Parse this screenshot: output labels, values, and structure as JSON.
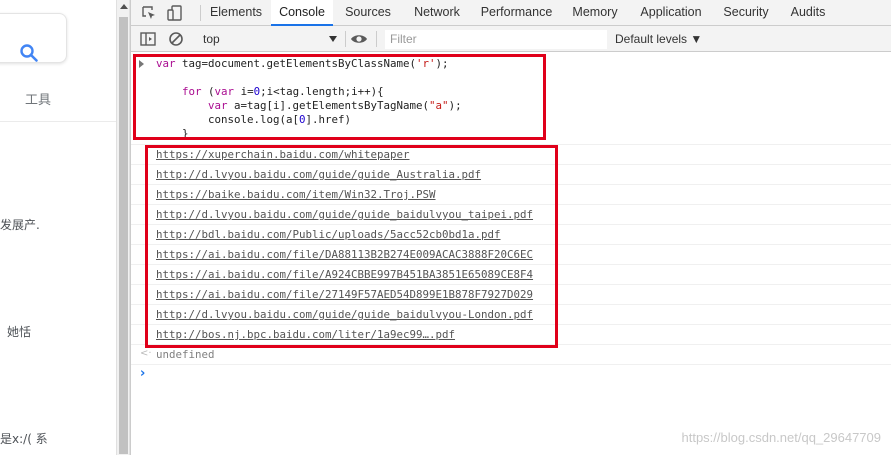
{
  "page": {
    "tools_label": "工具",
    "snippets": [
      "发展产.",
      "她恬",
      "是x:/( 系"
    ]
  },
  "devtools": {
    "tabs": [
      "Elements",
      "Console",
      "Sources",
      "Network",
      "Performance",
      "Memory",
      "Application",
      "Security",
      "Audits"
    ],
    "active_tab": "Console",
    "context": "top",
    "filter_placeholder": "Filter",
    "levels": "Default levels ▼"
  },
  "console": {
    "code_lines": [
      "var tag=document.getElementsByClassName('r');",
      "",
      "    for (var i=0;i<tag.length;i++){",
      "        var a=tag[i].getElementsByTagName(\"a\");",
      "        console.log(a[0].href)",
      "    }"
    ],
    "outputs": [
      "https://xuperchain.baidu.com/whitepaper",
      "http://d.lvyou.baidu.com/guide/guide_Australia.pdf",
      "https://baike.baidu.com/item/Win32.Troj.PSW",
      "http://d.lvyou.baidu.com/guide/guide_baidulvyou_taipei.pdf",
      "http://bdl.baidu.com/Public/uploads/5acc52cb0bd1a.pdf",
      "https://ai.baidu.com/file/DA88113B2B274E009ACAC3888F20C6EC",
      "https://ai.baidu.com/file/A924CBBE997B451BA3851E65089CE8F4",
      "https://ai.baidu.com/file/27149F57AED54D899E1B878F7927D029",
      "http://d.lvyou.baidu.com/guide/guide_baidulvyou-London.pdf",
      "http://bos.nj.bpc.baidu.com/liter/1a9ec99….pdf"
    ],
    "return_value": "undefined"
  },
  "watermark": "https://blog.csdn.net/qq_29647709",
  "colors": {
    "highlight_box": "#e0001a",
    "active_tab": "#1a73e8"
  }
}
